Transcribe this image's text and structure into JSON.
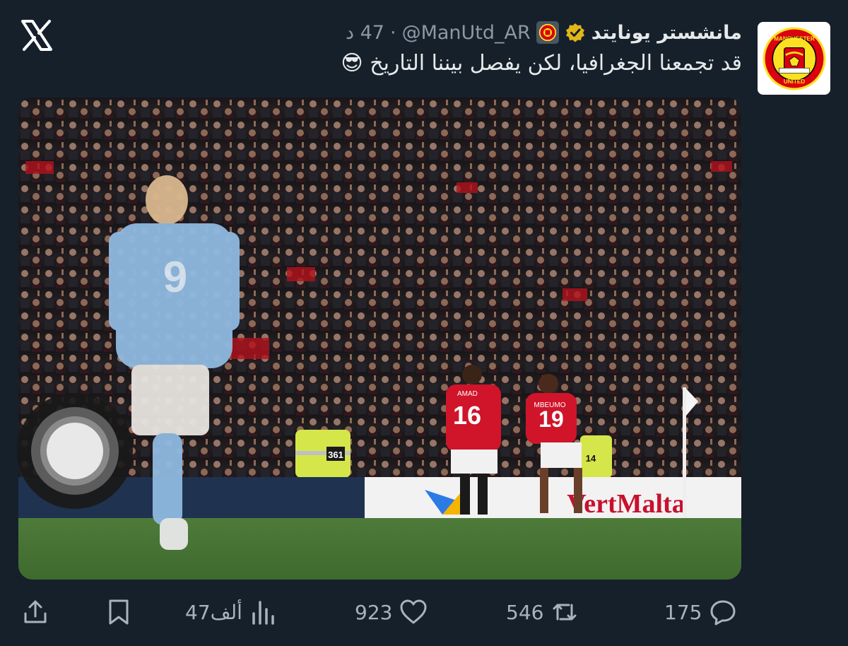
{
  "account": {
    "display_name": "مانشستر يونايتد",
    "handle": "@ManUtd_AR",
    "separator": "·",
    "time": "47 د",
    "avatar_icon": "man-utd-crest",
    "crest_text": "MANCHESTER UNITED"
  },
  "tweet": {
    "text": "قد تجمعنا الجغرافيا، لكن يفصل بيننا التاريخ",
    "emoji": "😎"
  },
  "media": {
    "scene_text": {
      "player_left_number": "9",
      "player_a_name": "AMAD",
      "player_a_number": "16",
      "player_b_name": "MBEUMO",
      "player_b_number": "19",
      "steward_number_1": "361",
      "steward_number_2": "14",
      "board_text": "VertMalta"
    }
  },
  "actions": {
    "replies": "175",
    "reposts": "546",
    "likes": "923",
    "views": "47ألف"
  },
  "colors": {
    "background": "#15202b",
    "text_primary": "#e7e9ea",
    "text_secondary": "#8b98a5",
    "verified": "#e2b719",
    "utd_red": "#da020e"
  }
}
